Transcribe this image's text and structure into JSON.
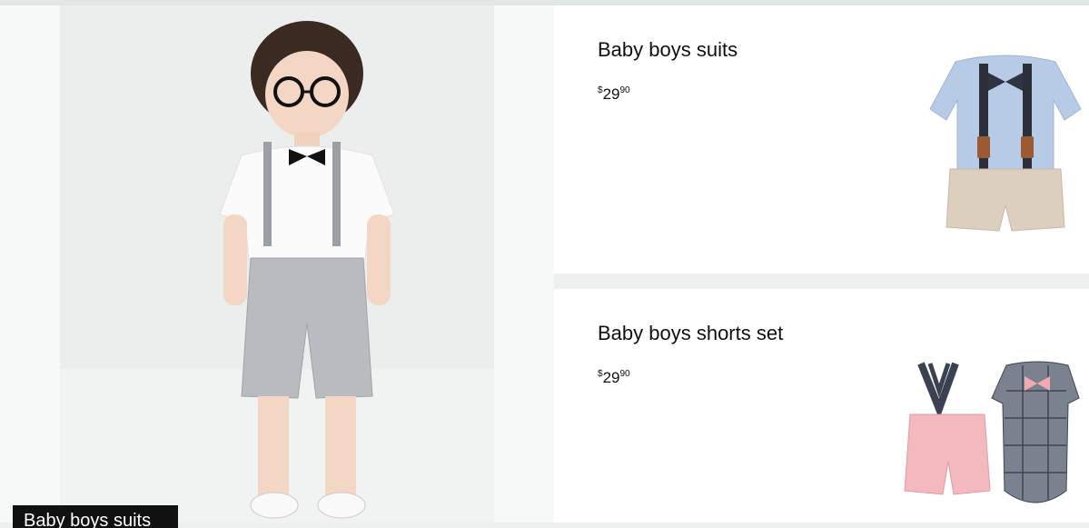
{
  "hero": {
    "image_name": "boy-in-suspender-outfit-photo",
    "caption": "Baby boys suits"
  },
  "products": [
    {
      "title": "Baby boys suits",
      "price": {
        "symbol": "$",
        "whole": "29",
        "fraction": "90"
      },
      "image_name": "blue-shirt-suspender-shorts-set"
    },
    {
      "title": "Baby boys shorts set",
      "price": {
        "symbol": "$",
        "whole": "29",
        "fraction": "90"
      },
      "image_name": "plaid-bodysuit-pink-shorts-set"
    }
  ]
}
